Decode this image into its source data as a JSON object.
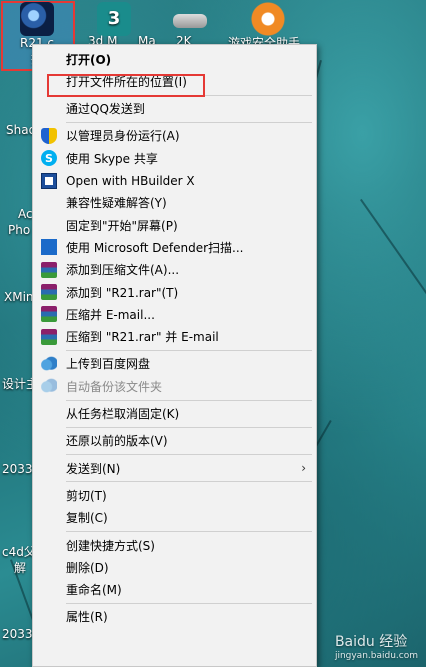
{
  "desktop": {
    "icons_top": [
      {
        "label": "R21.c",
        "sub": "捷",
        "name": "cinema4d-r21-shortcut"
      },
      {
        "label": "",
        "name": "3dsmax-icon"
      },
      {
        "label": "",
        "name": "scanner-icon"
      },
      {
        "label": "",
        "name": "orange-app-icon"
      }
    ],
    "top_fragments": [
      "3d M",
      "Ma",
      "2K",
      "游戏安全助手"
    ],
    "left_labels": [
      "Shad",
      "Ac",
      "Pho",
      "XMin",
      "设计主",
      "2033",
      "c4d父",
      "解",
      "2033"
    ]
  },
  "menu": {
    "items": [
      {
        "label": "打开(O)",
        "icon": "none",
        "bold": true,
        "disabled": false
      },
      {
        "label": "打开文件所在的位置(I)",
        "icon": "none",
        "bold": false,
        "disabled": false
      },
      {
        "sep": true
      },
      {
        "label": "通过QQ发送到",
        "icon": "none",
        "bold": false,
        "disabled": false
      },
      {
        "sep": true
      },
      {
        "label": "以管理员身份运行(A)",
        "icon": "shield-icon",
        "bold": false,
        "disabled": false
      },
      {
        "label": "使用 Skype 共享",
        "icon": "skype-icon",
        "bold": false,
        "disabled": false
      },
      {
        "label": "Open with HBuilder X",
        "icon": "hbuilder-icon",
        "bold": false,
        "disabled": false
      },
      {
        "label": "兼容性疑难解答(Y)",
        "icon": "none",
        "bold": false,
        "disabled": false
      },
      {
        "label": "固定到\"开始\"屏幕(P)",
        "icon": "none",
        "bold": false,
        "disabled": false
      },
      {
        "label": "使用 Microsoft Defender扫描...",
        "icon": "defender-icon",
        "bold": false,
        "disabled": false
      },
      {
        "label": "添加到压缩文件(A)...",
        "icon": "winrar-icon",
        "bold": false,
        "disabled": false
      },
      {
        "label": "添加到 \"R21.rar\"(T)",
        "icon": "winrar-icon",
        "bold": false,
        "disabled": false
      },
      {
        "label": "压缩并 E-mail...",
        "icon": "winrar-icon",
        "bold": false,
        "disabled": false
      },
      {
        "label": "压缩到 \"R21.rar\" 并 E-mail",
        "icon": "winrar-icon",
        "bold": false,
        "disabled": false
      },
      {
        "sep": true
      },
      {
        "label": "上传到百度网盘",
        "icon": "baidu-cloud-icon",
        "bold": false,
        "disabled": false
      },
      {
        "label": "自动备份该文件夹",
        "icon": "baidu-cloud-icon",
        "bold": false,
        "disabled": true
      },
      {
        "sep": true
      },
      {
        "label": "从任务栏取消固定(K)",
        "icon": "none",
        "bold": false,
        "disabled": false
      },
      {
        "sep": true
      },
      {
        "label": "还原以前的版本(V)",
        "icon": "none",
        "bold": false,
        "disabled": false
      },
      {
        "sep": true
      },
      {
        "label": "发送到(N)",
        "icon": "none",
        "bold": false,
        "disabled": false,
        "submenu": true
      },
      {
        "sep": true
      },
      {
        "label": "剪切(T)",
        "icon": "none",
        "bold": false,
        "disabled": false
      },
      {
        "label": "复制(C)",
        "icon": "none",
        "bold": false,
        "disabled": false
      },
      {
        "sep": true
      },
      {
        "label": "创建快捷方式(S)",
        "icon": "none",
        "bold": false,
        "disabled": false
      },
      {
        "label": "删除(D)",
        "icon": "none",
        "bold": false,
        "disabled": false
      },
      {
        "label": "重命名(M)",
        "icon": "none",
        "bold": false,
        "disabled": false
      },
      {
        "sep": true
      },
      {
        "label": "属性(R)",
        "icon": "none",
        "bold": false,
        "disabled": false
      }
    ],
    "submenu_arrow": "›"
  },
  "watermark": {
    "main": "Baidu 经验",
    "sub": "jingyan.baidu.com"
  },
  "colors": {
    "highlight_border": "#e53935",
    "menu_bg": "#f2f2f2"
  }
}
